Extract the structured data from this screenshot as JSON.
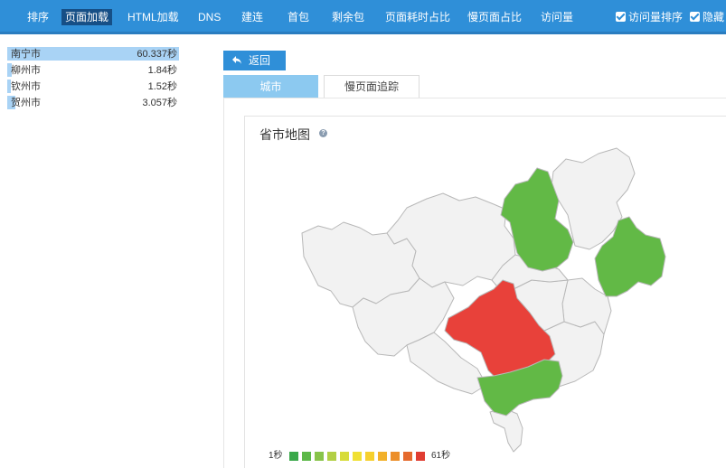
{
  "nav": {
    "items": [
      "排序",
      "页面加载",
      "HTML加载",
      "DNS",
      "建连",
      "首包",
      "剩余包",
      "页面耗时占比",
      "慢页面占比",
      "访问量"
    ],
    "active_index": 1,
    "checkbox_visits_sort": "访问量排序",
    "checkbox_hide": "隐藏"
  },
  "cities": [
    {
      "name": "南宁市",
      "value": "60.337秒",
      "level": 1.0
    },
    {
      "name": "柳州市",
      "value": "1.84秒",
      "level": 0.03
    },
    {
      "name": "钦州市",
      "value": "1.52秒",
      "level": 0.025
    },
    {
      "name": "贺州市",
      "value": "3.057秒",
      "level": 0.05
    }
  ],
  "back_button": "返回",
  "tabs": [
    "城市",
    "慢页面追踪"
  ],
  "active_tab": 0,
  "map": {
    "title": "省市地图",
    "legend_min": "1秒",
    "legend_max": "61秒",
    "legend_colors": [
      "#3aa84a",
      "#5cb848",
      "#88c44a",
      "#b2cf45",
      "#d7dc3a",
      "#f0e033",
      "#f6d02e",
      "#f2b12b",
      "#ec8f2a",
      "#e56a2d",
      "#e03d32"
    ],
    "region_colors": {
      "default": "#f2f2f2",
      "high": "#e8413a",
      "low": "#62b946",
      "border": "#b8b8b8"
    }
  }
}
